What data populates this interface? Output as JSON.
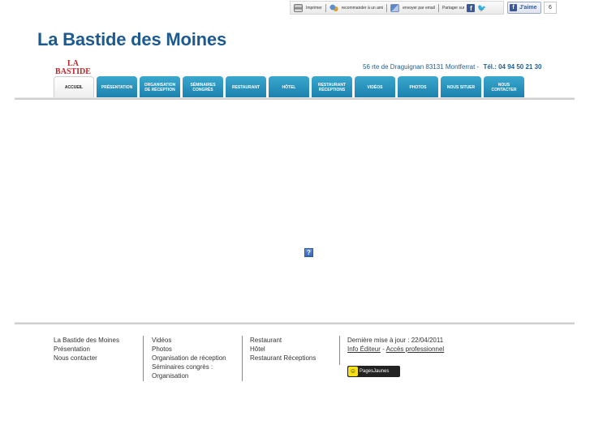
{
  "sharebar": {
    "print_label": "Imprimer",
    "recommend_label": "recommander à un ami",
    "email_label": "envoyer par email",
    "share_label": "Partager sur"
  },
  "like": {
    "label": "J'aime",
    "count": "6"
  },
  "header": {
    "site_title": "La Bastide des Moines",
    "logo_text": "LA BASTIDE",
    "address": "56 rte de Draguignan 83131 Montferrat -",
    "phone": "Tél.: 04 94 50 21 30"
  },
  "nav": {
    "tabs": [
      {
        "label": "Accueil"
      },
      {
        "label": "Présentation"
      },
      {
        "label": "Organisation de réception"
      },
      {
        "label": "Séminaires congrès"
      },
      {
        "label": "Restaurant"
      },
      {
        "label": "Hôtel"
      },
      {
        "label": "Restaurant réceptions"
      },
      {
        "label": "Vidéos"
      },
      {
        "label": "Photos"
      },
      {
        "label": "Nous situer"
      },
      {
        "label": "Nous contacter"
      }
    ]
  },
  "main": {
    "missing_plugin_glyph": "?"
  },
  "footer": {
    "col1": [
      "La Bastide des Moines",
      "Présentation",
      "Nous contacter"
    ],
    "col2": [
      "Vidéos",
      "Photos",
      "Organisation de réception",
      "Séminaires congrès :",
      "Organisation"
    ],
    "col3": [
      "Restaurant",
      "Hôtel",
      "Restaurant Réceptions"
    ],
    "last_update": "Dernière mise à jour : 22/04/2011",
    "info_editeur": "Info Éditeur",
    "link_sep": "-",
    "acces_pro": "Accès professionnel",
    "pj_text": "PagesJaunes"
  }
}
